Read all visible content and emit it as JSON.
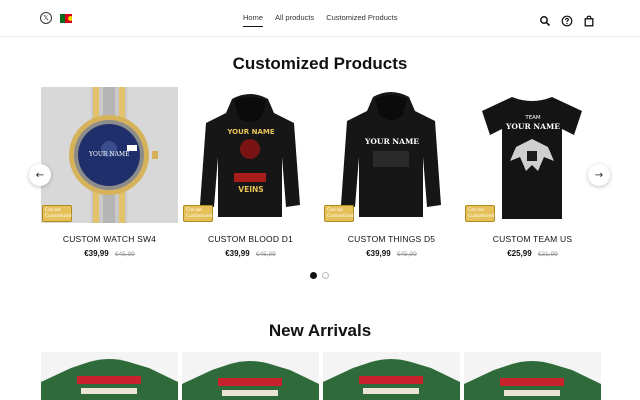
{
  "header": {
    "nav": [
      {
        "label": "Home",
        "active": true
      },
      {
        "label": "All products",
        "active": false
      },
      {
        "label": "Customized Products",
        "active": false
      }
    ],
    "icons": [
      "x-logo-icon",
      "portugal-flag-icon",
      "search-icon",
      "help-icon",
      "shopping-bag-icon"
    ]
  },
  "sections": {
    "customized_title": "Customized Products",
    "arrivals_title": "New Arrivals"
  },
  "products": [
    {
      "name": "CUSTOM WATCH SW4",
      "price": "€39,99",
      "old_price": "€45,99",
      "badge": "Can be Customized"
    },
    {
      "name": "CUSTOM BLOOD D1",
      "price": "€39,99",
      "old_price": "€45,99",
      "badge": "Can be Customized"
    },
    {
      "name": "CUSTOM THINGS D5",
      "price": "€39,99",
      "old_price": "€45,99",
      "badge": "Can be Customized"
    },
    {
      "name": "CUSTOM TEAM US",
      "price": "€25,99",
      "old_price": "€31,99",
      "badge": "Can be Customized"
    }
  ],
  "product_art": {
    "watch_text": "YOUR NAME",
    "blood_top": "YOUR NAME",
    "blood_bottom": "VEINS",
    "things_top": "YOUR NAME",
    "team_top": "TEAM",
    "team_mid": "YOUR NAME"
  },
  "carousel": {
    "page_count": 2,
    "current_page": 1
  },
  "colors": {
    "accent": "#111111",
    "badge": "#e6c15a",
    "sweater_green": "#2f6b3a",
    "sweater_red": "#c8232c"
  }
}
